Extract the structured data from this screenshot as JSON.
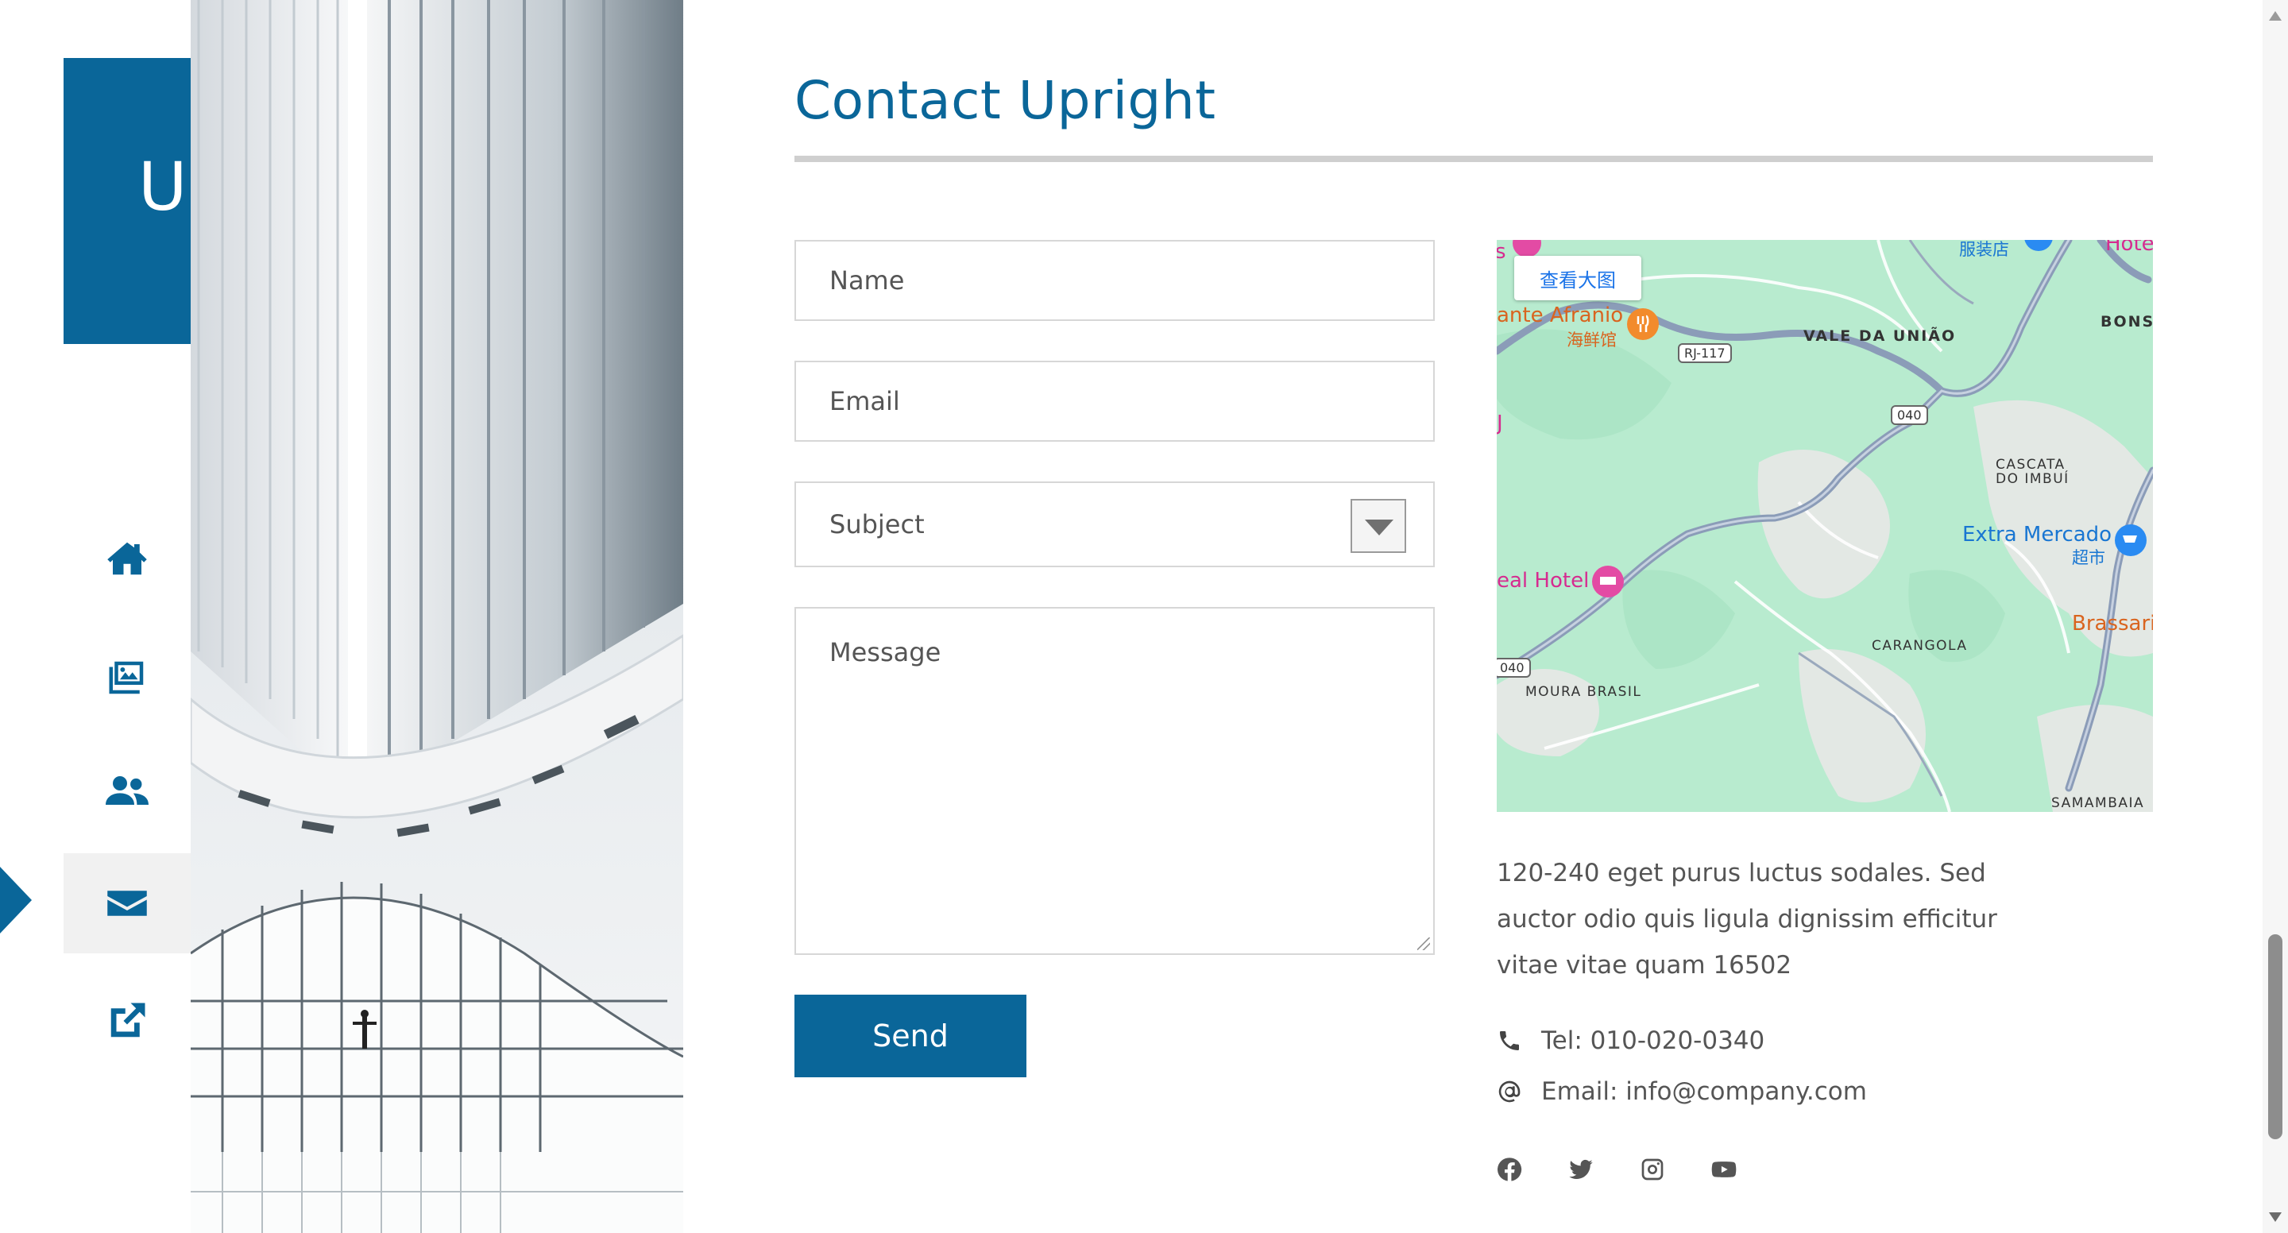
{
  "sidebar": {
    "brand_letter": "U",
    "nav": [
      {
        "icon": "home-icon",
        "active": false
      },
      {
        "icon": "gallery-icon",
        "active": false
      },
      {
        "icon": "users-icon",
        "active": false
      },
      {
        "icon": "envelope-icon",
        "active": true
      },
      {
        "icon": "external-link-icon",
        "active": false
      }
    ]
  },
  "main": {
    "title": "Contact Upright",
    "form": {
      "name_placeholder": "Name",
      "email_placeholder": "Email",
      "subject_placeholder": "Subject",
      "message_placeholder": "Message",
      "send_label": "Send"
    }
  },
  "map": {
    "view_larger": "查看大图",
    "labels": {
      "restaurant": "ante Afranio",
      "restaurant_sub": "海鲜馆",
      "vale": "VALE DA UNIÃO",
      "bons": "BONS",
      "cascata_1": "CASCATA",
      "cascata_2": "DO IMBUÍ",
      "extra": "Extra Mercado",
      "extra_sub": "超市",
      "hotel": "eal Hotel",
      "brassari": "Brassari",
      "carangola": "CARANGOLA",
      "moura": "MOURA BRASIL",
      "samambaia": "SAMAMBAIA",
      "clothing": "服装店",
      "hote": "Hote",
      "s_left": "s",
      "j_left": "J"
    },
    "shields": {
      "rj117": "RJ-117",
      "r040a": "040",
      "r040b": "040"
    }
  },
  "contact": {
    "address_lines": [
      "120-240 eget purus luctus sodales. Sed",
      "auctor odio quis ligula dignissim efficitur",
      "vitae vitae quam 16502"
    ],
    "tel": "Tel: 010-020-0340",
    "email": "Email: info@company.com",
    "social_icons": [
      "facebook-icon",
      "twitter-icon",
      "instagram-icon",
      "youtube-icon"
    ]
  },
  "colors": {
    "brand": "#0a6699",
    "map_land": "#b8ebcf",
    "rule": "#cfcfcf"
  }
}
